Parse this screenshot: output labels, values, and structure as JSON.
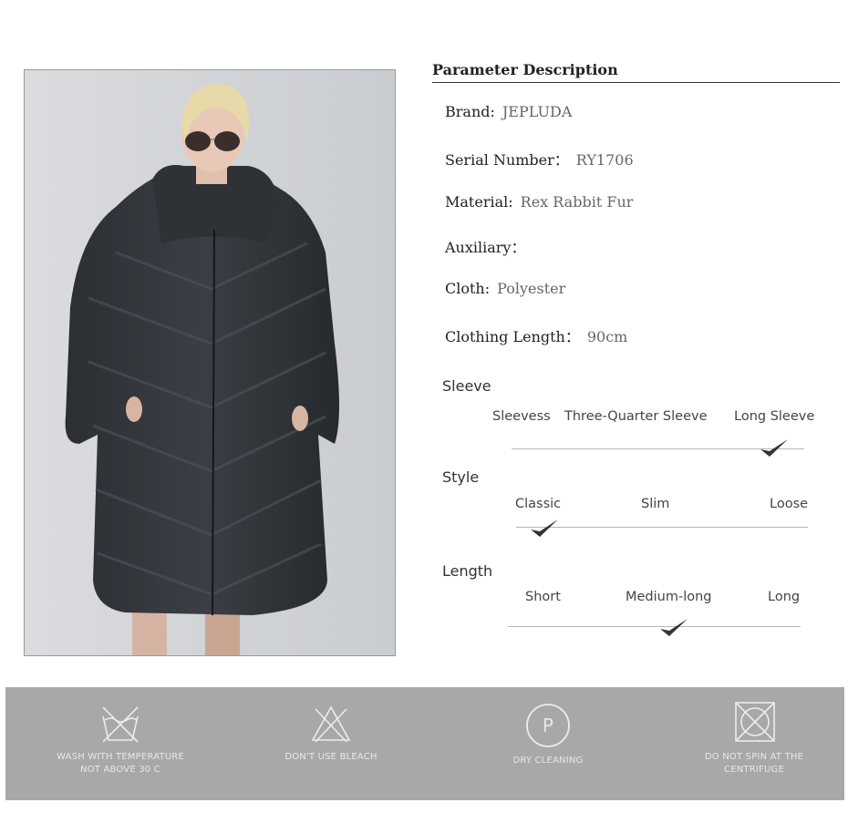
{
  "parameters": {
    "title": "Parameter Description",
    "brand": {
      "label": "Brand:",
      "value": "JEPLUDA"
    },
    "serial": {
      "label": "Serial Number：",
      "value": "RY1706"
    },
    "material": {
      "label": "Material:",
      "value": "Rex Rabbit Fur"
    },
    "auxiliary": {
      "label": "Auxiliary：",
      "value": ""
    },
    "cloth": {
      "label": "Cloth:",
      "value": "Polyester"
    },
    "length": {
      "label": "Clothing Length：",
      "value": "90cm"
    }
  },
  "sleeve": {
    "label": "Sleeve",
    "options": [
      "Sleevess",
      "Three-Quarter Sleeve",
      "Long Sleeve"
    ],
    "selected": "Long Sleeve"
  },
  "style": {
    "label": "Style",
    "options": [
      "Classic",
      "Slim",
      "Loose"
    ],
    "selected": "Classic"
  },
  "length_scale": {
    "label": "Length",
    "options": [
      "Short",
      "Medium-long",
      "Long"
    ],
    "selected": "Medium-long"
  },
  "care": [
    {
      "icon": "hand-wash-icon",
      "line1": "WASH WITH TEMPERATURE",
      "line2": "NOT ABOVE 30 C"
    },
    {
      "icon": "no-bleach-icon",
      "line1": "DON'T USE BLEACH",
      "line2": ""
    },
    {
      "icon": "dry-clean-icon",
      "line1": "DRY CLEANING",
      "line2": ""
    },
    {
      "icon": "no-spin-dry-icon",
      "line1": "DO NOT SPIN AT THE",
      "line2": "CENTRIFUGE"
    }
  ],
  "care_dry_clean_letter": "P",
  "colors": {
    "care_band": "#a8a8aa",
    "care_text": "#e8e8e8",
    "check": "#333333"
  }
}
